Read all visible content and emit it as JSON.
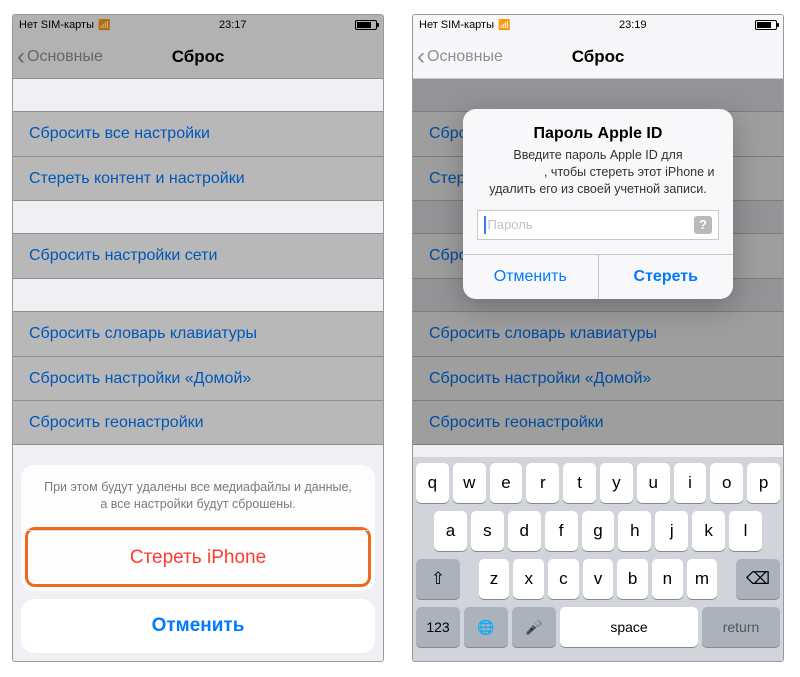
{
  "left": {
    "status": {
      "carrier": "Нет SIM-карты",
      "time": "23:17"
    },
    "nav": {
      "back": "Основные",
      "title": "Сброс"
    },
    "rows": {
      "g1r1": "Сбросить все настройки",
      "g1r2": "Стереть контент и настройки",
      "g2r1": "Сбросить настройки сети",
      "g3r1": "Сбросить словарь клавиатуры",
      "g3r2": "Сбросить настройки «Домой»",
      "g3r3": "Сбросить геонастройки"
    },
    "sheet": {
      "message": "При этом будут удалены все медиафайлы и данные, а все настройки будут сброшены.",
      "erase": "Стереть iPhone",
      "cancel": "Отменить"
    }
  },
  "right": {
    "status": {
      "carrier": "Нет SIM-карты",
      "time": "23:19"
    },
    "nav": {
      "back": "Основные",
      "title": "Сброс"
    },
    "rows": {
      "g1r1": "Сбросить все настройки",
      "g1r2": "Стереть контент и настройки",
      "g2r1": "Сбросить настройки сети",
      "g3r1": "Сбросить словарь клавиатуры",
      "g3r2": "Сбросить настройки «Домой»",
      "g3r3": "Сбросить геонастройки"
    },
    "alert": {
      "title": "Пароль Apple ID",
      "message": "Введите пароль Apple ID для                   , чтобы стереть этот iPhone и удалить его из своей учетной записи.",
      "placeholder": "Пароль",
      "cancel": "Отменить",
      "confirm": "Стереть"
    },
    "keyboard": {
      "row1": [
        "q",
        "w",
        "e",
        "r",
        "t",
        "y",
        "u",
        "i",
        "o",
        "p"
      ],
      "row2": [
        "a",
        "s",
        "d",
        "f",
        "g",
        "h",
        "j",
        "k",
        "l"
      ],
      "row3": [
        "z",
        "x",
        "c",
        "v",
        "b",
        "n",
        "m"
      ],
      "shift": "⇧",
      "backspace": "⌫",
      "numbers": "123",
      "globe": "🌐",
      "mic": "🎤",
      "space": "space",
      "return": "return"
    }
  }
}
